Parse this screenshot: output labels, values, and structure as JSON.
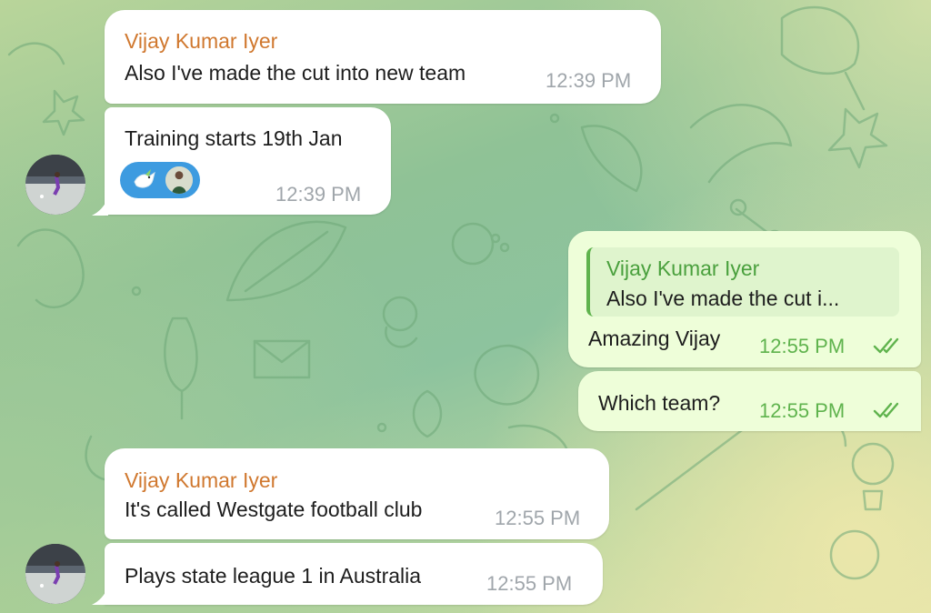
{
  "chat": {
    "messages": [
      {
        "sender": "Vijay Kumar Iyer",
        "text": "Also I've made the cut into new team",
        "time": "12:39 PM",
        "direction": "incoming"
      },
      {
        "text": "Training starts 19th Jan",
        "time": "12:39 PM",
        "direction": "incoming",
        "reaction": {
          "icon": "dove-emoji-icon",
          "reactor": "reactor-avatar"
        }
      },
      {
        "reply": {
          "sender": "Vijay Kumar Iyer",
          "text": "Also I've made the cut i..."
        },
        "text": "Amazing Vijay",
        "time": "12:55 PM",
        "direction": "outgoing",
        "status": "read-double-check-icon"
      },
      {
        "text": "Which team?",
        "time": "12:55 PM",
        "direction": "outgoing",
        "status": "read-double-check-icon"
      },
      {
        "sender": "Vijay Kumar Iyer",
        "text": "It's called Westgate football club",
        "time": "12:55 PM",
        "direction": "incoming"
      },
      {
        "text": "Plays state league 1 in Australia",
        "time": "12:55 PM",
        "direction": "incoming"
      }
    ]
  },
  "colors": {
    "incoming_bubble": "#ffffff",
    "outgoing_bubble": "#eefed9",
    "sender_name": "#d0782f",
    "reply_name": "#4aa03d",
    "outgoing_time": "#5fb34d",
    "incoming_time": "#a0a6ab",
    "reaction_badge": "#3d9be0"
  }
}
